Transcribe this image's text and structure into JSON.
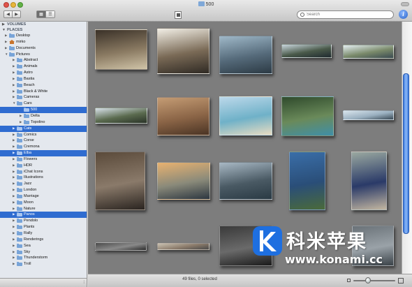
{
  "window": {
    "title": "500"
  },
  "toolbar": {
    "back_glyph": "◀",
    "forward_glyph": "▶",
    "view_thumbs_glyph": "▦",
    "view_list_glyph": "☰",
    "search_placeholder": "Search",
    "info_glyph": "i"
  },
  "sidebar": {
    "sections": [
      {
        "label": "VOLUMES",
        "collapsed": true
      },
      {
        "label": "PLACES",
        "collapsed": false
      }
    ],
    "rows": [
      {
        "label": "Desktop",
        "depth": 1,
        "icon": "folder-icon",
        "disclosure": "collapsed",
        "selected": false
      },
      {
        "label": "mirko",
        "depth": 1,
        "icon": "home-icon",
        "disclosure": "collapsed",
        "selected": false
      },
      {
        "label": "Documents",
        "depth": 1,
        "icon": "folder-icon",
        "disclosure": "collapsed",
        "selected": false
      },
      {
        "label": "Pictures",
        "depth": 1,
        "icon": "folder-icon",
        "disclosure": "expanded",
        "selected": false
      },
      {
        "label": "Abstract",
        "depth": 2,
        "icon": "folder-icon",
        "disclosure": "collapsed",
        "selected": false
      },
      {
        "label": "Animals",
        "depth": 2,
        "icon": "folder-icon",
        "disclosure": "collapsed",
        "selected": false
      },
      {
        "label": "Astro",
        "depth": 2,
        "icon": "folder-icon",
        "disclosure": "collapsed",
        "selected": false
      },
      {
        "label": "Bastia",
        "depth": 2,
        "icon": "folder-icon",
        "disclosure": "collapsed",
        "selected": false
      },
      {
        "label": "Beach",
        "depth": 2,
        "icon": "folder-icon",
        "disclosure": "collapsed",
        "selected": false
      },
      {
        "label": "Black & White",
        "depth": 2,
        "icon": "folder-icon",
        "disclosure": "collapsed",
        "selected": false
      },
      {
        "label": "Cameras",
        "depth": 2,
        "icon": "folder-icon",
        "disclosure": "collapsed",
        "selected": false
      },
      {
        "label": "Cars",
        "depth": 2,
        "icon": "folder-icon",
        "disclosure": "expanded",
        "selected": false
      },
      {
        "label": "500",
        "depth": 3,
        "icon": "folder-icon",
        "disclosure": "none",
        "selected": true
      },
      {
        "label": "Delta",
        "depth": 3,
        "icon": "folder-icon",
        "disclosure": "collapsed",
        "selected": false
      },
      {
        "label": "Topolino",
        "depth": 3,
        "icon": "folder-icon",
        "disclosure": "collapsed",
        "selected": false
      },
      {
        "label": "Cats",
        "depth": 2,
        "icon": "folder-icon",
        "disclosure": "collapsed",
        "selected": true
      },
      {
        "label": "Comics",
        "depth": 2,
        "icon": "folder-icon",
        "disclosure": "collapsed",
        "selected": false
      },
      {
        "label": "Corse",
        "depth": 2,
        "icon": "folder-icon",
        "disclosure": "collapsed",
        "selected": false
      },
      {
        "label": "Cremona",
        "depth": 2,
        "icon": "folder-icon",
        "disclosure": "collapsed",
        "selected": false
      },
      {
        "label": "Elba",
        "depth": 2,
        "icon": "folder-icon",
        "disclosure": "collapsed",
        "selected": true
      },
      {
        "label": "Flowers",
        "depth": 2,
        "icon": "folder-icon",
        "disclosure": "collapsed",
        "selected": false
      },
      {
        "label": "HDR",
        "depth": 2,
        "icon": "folder-icon",
        "disclosure": "collapsed",
        "selected": false
      },
      {
        "label": "iChat Icons",
        "depth": 2,
        "icon": "folder-icon",
        "disclosure": "collapsed",
        "selected": false
      },
      {
        "label": "Illustrations",
        "depth": 2,
        "icon": "folder-icon",
        "disclosure": "collapsed",
        "selected": false
      },
      {
        "label": "Jazz",
        "depth": 2,
        "icon": "folder-icon",
        "disclosure": "collapsed",
        "selected": false
      },
      {
        "label": "London",
        "depth": 2,
        "icon": "folder-icon",
        "disclosure": "collapsed",
        "selected": false
      },
      {
        "label": "Marriage",
        "depth": 2,
        "icon": "folder-icon",
        "disclosure": "collapsed",
        "selected": false
      },
      {
        "label": "Moon",
        "depth": 2,
        "icon": "folder-icon",
        "disclosure": "collapsed",
        "selected": false
      },
      {
        "label": "Nature",
        "depth": 2,
        "icon": "folder-icon",
        "disclosure": "collapsed",
        "selected": false
      },
      {
        "label": "Panos",
        "depth": 2,
        "icon": "folder-icon",
        "disclosure": "collapsed",
        "selected": true
      },
      {
        "label": "Pendolo",
        "depth": 2,
        "icon": "folder-icon",
        "disclosure": "collapsed",
        "selected": false
      },
      {
        "label": "Plants",
        "depth": 2,
        "icon": "folder-icon",
        "disclosure": "collapsed",
        "selected": false
      },
      {
        "label": "Rally",
        "depth": 2,
        "icon": "folder-icon",
        "disclosure": "collapsed",
        "selected": false
      },
      {
        "label": "Renderings",
        "depth": 2,
        "icon": "folder-icon",
        "disclosure": "collapsed",
        "selected": false
      },
      {
        "label": "Sea",
        "depth": 2,
        "icon": "folder-icon",
        "disclosure": "collapsed",
        "selected": false
      },
      {
        "label": "Sky",
        "depth": 2,
        "icon": "folder-icon",
        "disclosure": "collapsed",
        "selected": false
      },
      {
        "label": "Thunderstorm",
        "depth": 2,
        "icon": "folder-icon",
        "disclosure": "collapsed",
        "selected": false
      },
      {
        "label": "Troll",
        "depth": 2,
        "icon": "folder-icon",
        "disclosure": "collapsed",
        "selected": false
      }
    ]
  },
  "thumbnails": [
    {
      "name": "thumb-street-kid",
      "palette": [
        "#3a3128",
        "#8a7a62",
        "#d0c4a8"
      ]
    },
    {
      "name": "thumb-cat-window",
      "palette": [
        "#f2efe6",
        "#7a6a56",
        "#2f2a24"
      ]
    },
    {
      "name": "thumb-lighthouse-harbor",
      "palette": [
        "#9fb8c8",
        "#556a7a",
        "#2c3a44"
      ]
    },
    {
      "name": "thumb-pano-bay",
      "palette": [
        "#c9d6dd",
        "#4a5a4a",
        "#1f2a30"
      ]
    },
    {
      "name": "thumb-pano-coast",
      "palette": [
        "#e4eef2",
        "#7a8a6a",
        "#3a4a52"
      ]
    },
    {
      "name": "thumb-pano-hills",
      "palette": [
        "#d8e2ea",
        "#5b6b4f",
        "#2a3328"
      ]
    },
    {
      "name": "thumb-orange-cat",
      "palette": [
        "#c49c74",
        "#8a6446",
        "#4a3424"
      ]
    },
    {
      "name": "thumb-beach",
      "palette": [
        "#bcd8ea",
        "#6fb1c8",
        "#e8dcc2"
      ]
    },
    {
      "name": "thumb-green-coast",
      "palette": [
        "#2f4a2c",
        "#6a8a5a",
        "#3f8fa8"
      ]
    },
    {
      "name": "thumb-pano-sea",
      "palette": [
        "#d8e4ec",
        "#9ab0c0",
        "#3a4a56"
      ]
    },
    {
      "name": "thumb-car-workshop",
      "palette": [
        "#5a4a3a",
        "#8a7a6a",
        "#2a2420"
      ]
    },
    {
      "name": "thumb-sunset-sea",
      "palette": [
        "#e8b270",
        "#8a8a7a",
        "#2c3640"
      ]
    },
    {
      "name": "thumb-rocky-coast",
      "palette": [
        "#a8b8c4",
        "#4a5a64",
        "#2a3a44"
      ]
    },
    {
      "name": "thumb-island-rock",
      "palette": [
        "#3a6ea8",
        "#2a4e78",
        "#4a6a3a"
      ]
    },
    {
      "name": "thumb-blue-500",
      "palette": [
        "#9aa8a0",
        "#2a3a68",
        "#c2b6a0"
      ]
    },
    {
      "name": "thumb-pano-crowd",
      "palette": [
        "#4a4a4a",
        "#8a8a8a",
        "#2a2a2a"
      ]
    },
    {
      "name": "thumb-pano-harbor",
      "palette": [
        "#c8c0b0",
        "#8a7a6a",
        "#4a4a4a"
      ]
    },
    {
      "name": "thumb-dark-sea",
      "palette": [
        "#3a3a3a",
        "#6a6a6a",
        "#1a1a1a"
      ]
    },
    {
      "name": "thumb-grey-sea",
      "palette": [
        "#6a7278",
        "#9aa2a8",
        "#3a4248"
      ]
    }
  ],
  "status": {
    "text": "49 files, 0 selected",
    "zoom_level": 0.35
  },
  "watermark": {
    "brand": "科米苹果",
    "url": "www.konami.cc"
  },
  "colors": {
    "selection": "#2f6cd0",
    "grid_background": "#7d7d7d",
    "sidebar_background": "#e4e8ee"
  }
}
